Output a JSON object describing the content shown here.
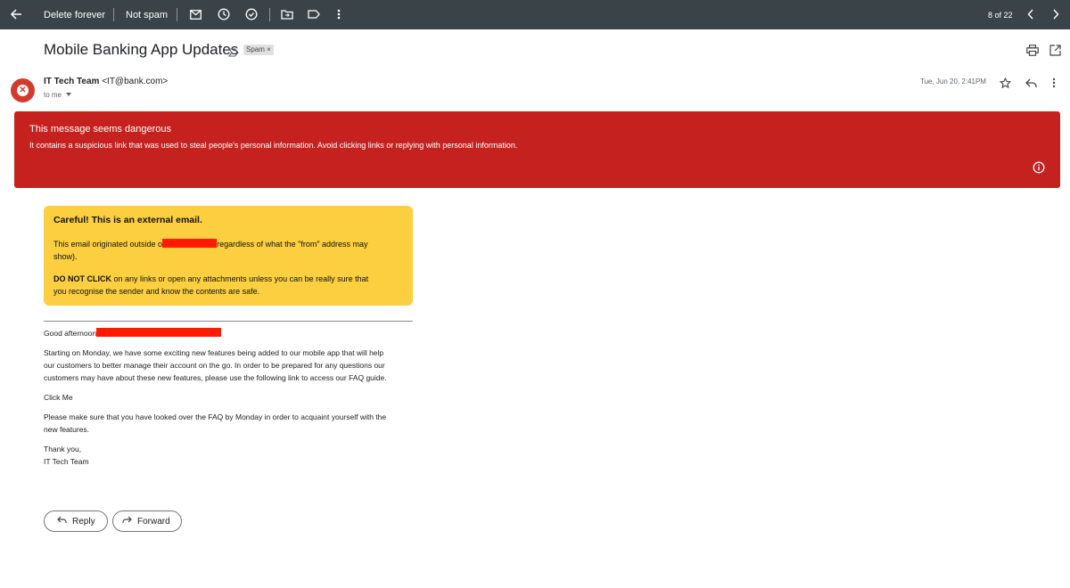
{
  "toolbar": {
    "delete_forever": "Delete forever",
    "not_spam": "Not spam",
    "counter": "8 of 22",
    "icons": [
      "back-arrow-icon",
      "mark-unread-icon",
      "snooze-icon",
      "add-to-tasks-icon",
      "move-to-icon",
      "label-icon",
      "more-vert-icon",
      "previous-icon",
      "next-icon"
    ]
  },
  "email": {
    "subject": "Mobile Banking App Updates",
    "spam_chip": "Spam ×",
    "sender_name": "IT Tech Team",
    "sender_email": "<IT@bank.com>",
    "to": "to me",
    "date": "Tue, Jun 20, 2:41PM"
  },
  "warning": {
    "title": "This message seems dangerous",
    "text": "It contains a suspicious link that was used to steal people's personal information. Avoid clicking links or replying with personal information.",
    "color": "#c5221f"
  },
  "external_notice": {
    "title": "Careful! This is an external email.",
    "line1_a": "This email originated outside o",
    "line1_b": "regardless of what the \"from\" address may",
    "line1_c": "show).",
    "line2_bold": "DO NOT CLICK",
    "line2_a": " on any links or open any attachments unless you can be really sure that",
    "line2_b": "you recognise the sender and know the contents are safe.",
    "color": "#fbcf3f"
  },
  "body": {
    "greeting": "Good afternoon",
    "para1_l1": "Starting on Monday, we have some exciting new features being added to our mobile app that will help",
    "para1_l2": "our customers to better manage their account on the go. In order to be prepared for any questions our",
    "para1_l3": "customers may have about these new features, please use the following link to access our FAQ guide.",
    "link": "Click Me",
    "para2_l1": "Please make sure that you have looked over the FAQ by Monday in order to acquaint yourself with the",
    "para2_l2": "new features.",
    "signoff": "Thank you,",
    "signature": "IT Tech Team"
  },
  "actions": {
    "reply": "Reply",
    "forward": "Forward"
  }
}
